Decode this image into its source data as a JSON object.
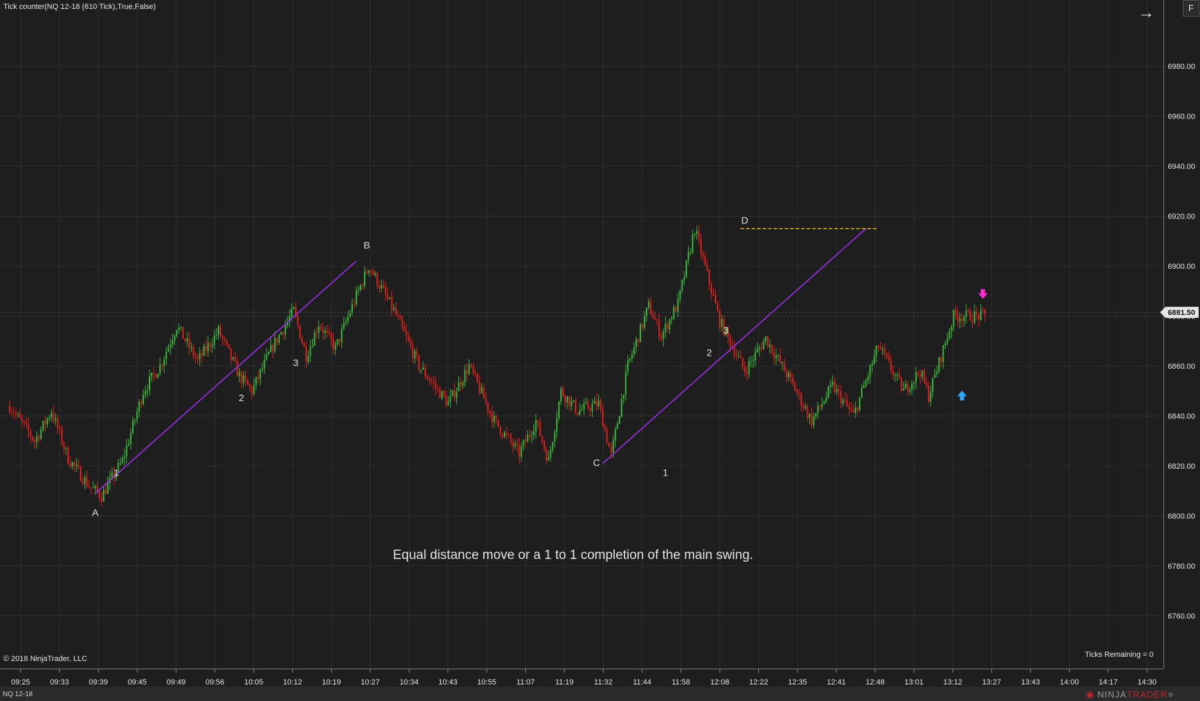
{
  "window": {
    "indicator_label": "Tick counter(NQ 12-18 (610 Tick),True,False)",
    "copyright": "© 2018 NinjaTrader, LLC",
    "ticks_remaining": "Ticks Remaining = 0",
    "instrument_tab": "NQ 12-18",
    "f_button": "F",
    "arrow_icon": "→",
    "logo_text_1": "NINJA",
    "logo_text_2": "TRADER",
    "logo_mark": "®",
    "annotation_note": "Equal distance move or a 1 to 1 completion of the main swing."
  },
  "colors": {
    "background": "#1e1e1e",
    "grid": "#2f2f2f",
    "up_bar": "#3cb83c",
    "down_bar": "#e0201c",
    "trendline": "#9b30e6",
    "level_line": "#f2c200",
    "price_marker_bg": "#e6e6e6",
    "sell_arrow": "#ff2bd6",
    "buy_arrow": "#2ea8ff"
  },
  "chart_data": {
    "type": "candlestick",
    "instrument": "NQ 12-18",
    "ylim": [
      6745,
      6995
    ],
    "y_ticks": [
      6760,
      6780,
      6800,
      6820,
      6840,
      6860,
      6880,
      6900,
      6920,
      6940,
      6960,
      6980
    ],
    "y_tick_labels": [
      "6760.00",
      "6780.00",
      "6800.00",
      "6820.00",
      "6840.00",
      "6860.00",
      "6880.00",
      "6900.00",
      "6920.00",
      "6940.00",
      "6960.00",
      "6980.00"
    ],
    "x_tick_labels": [
      "09:25",
      "09:33",
      "09:39",
      "09:45",
      "09:49",
      "09:56",
      "10:05",
      "10:12",
      "10:19",
      "10:27",
      "10:34",
      "10:43",
      "10:55",
      "11:07",
      "11:19",
      "11:32",
      "11:44",
      "11:58",
      "12:08",
      "12:22",
      "12:35",
      "12:41",
      "12:48",
      "13:01",
      "13:12",
      "13:27",
      "13:43",
      "14:00",
      "14:17",
      "14:30"
    ],
    "bar_count": 290,
    "price_path": [
      [
        0,
        6844
      ],
      [
        12,
        6830
      ],
      [
        20,
        6842
      ],
      [
        28,
        6823
      ],
      [
        38,
        6812
      ],
      [
        44,
        6808
      ],
      [
        54,
        6822
      ],
      [
        64,
        6850
      ],
      [
        72,
        6860
      ],
      [
        80,
        6876
      ],
      [
        90,
        6862
      ],
      [
        100,
        6874
      ],
      [
        110,
        6856
      ],
      [
        116,
        6850
      ],
      [
        126,
        6868
      ],
      [
        136,
        6882
      ],
      [
        142,
        6864
      ],
      [
        148,
        6877
      ],
      [
        156,
        6867
      ],
      [
        166,
        6888
      ],
      [
        172,
        6900
      ],
      [
        184,
        6882
      ],
      [
        196,
        6860
      ],
      [
        210,
        6845
      ],
      [
        220,
        6860
      ],
      [
        232,
        6838
      ],
      [
        244,
        6825
      ],
      [
        252,
        6838
      ],
      [
        258,
        6822
      ],
      [
        264,
        6850
      ],
      [
        272,
        6842
      ],
      [
        282,
        6845
      ],
      [
        288,
        6824
      ],
      [
        296,
        6860
      ],
      [
        306,
        6884
      ],
      [
        312,
        6872
      ],
      [
        320,
        6885
      ],
      [
        328,
        6915
      ],
      [
        340,
        6878
      ],
      [
        352,
        6858
      ],
      [
        362,
        6871
      ],
      [
        374,
        6854
      ],
      [
        384,
        6838
      ],
      [
        394,
        6852
      ],
      [
        404,
        6840
      ],
      [
        416,
        6868
      ],
      [
        428,
        6850
      ],
      [
        436,
        6858
      ],
      [
        440,
        6848
      ],
      [
        446,
        6864
      ],
      [
        452,
        6880
      ]
    ],
    "last_price": 6881.5,
    "last_price_label": "6881.50",
    "swing_labels": [
      {
        "text": "A",
        "bar": 41,
        "price": 6800
      },
      {
        "text": "1",
        "bar": 51,
        "price": 6816
      },
      {
        "text": "2",
        "bar": 111,
        "price": 6846
      },
      {
        "text": "3",
        "bar": 137,
        "price": 6860
      },
      {
        "text": "B",
        "bar": 171,
        "price": 6907
      },
      {
        "text": "C",
        "bar": 281,
        "price": 6820
      },
      {
        "text": "1",
        "bar": 314,
        "price": 6816
      },
      {
        "text": "2",
        "bar": 335,
        "price": 6864
      },
      {
        "text": "3",
        "bar": 343,
        "price": 6873
      },
      {
        "text": "D",
        "bar": 352,
        "price": 6917
      }
    ],
    "trendlines": [
      {
        "from": {
          "bar": 41,
          "price": 6809
        },
        "to": {
          "bar": 166,
          "price": 6902
        }
      },
      {
        "from": {
          "bar": 284,
          "price": 6821
        },
        "to": {
          "bar": 410,
          "price": 6915
        }
      }
    ],
    "level_lines": [
      {
        "price": 6915,
        "from_bar": 350,
        "to_bar": 415
      }
    ],
    "signal_markers": [
      {
        "type": "sell",
        "bar": 466,
        "price": 6888
      },
      {
        "type": "buy",
        "bar": 456,
        "price": 6849
      }
    ]
  }
}
